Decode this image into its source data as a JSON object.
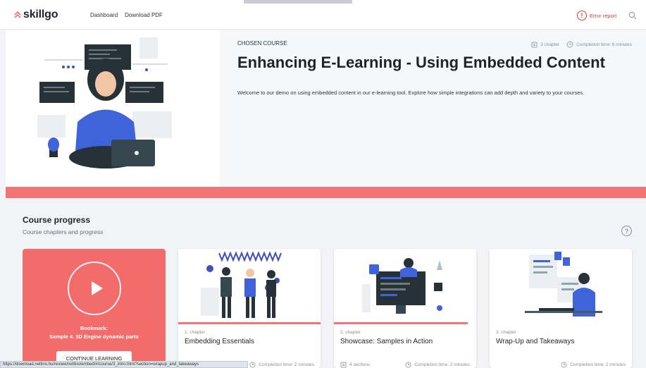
{
  "header": {
    "logo_text": "skillgo",
    "nav": [
      "Dashboard",
      "Download PDF"
    ],
    "error_report": "Error report",
    "error_symbol": "!"
  },
  "hero": {
    "kicker": "CHOSEN COURSE",
    "chapters": "3 chapter",
    "completion": "Completion time: 6 minutes",
    "title": "Enhancing E-Learning - Using Embedded Content",
    "description": "Welcome to our demo on using embedded content in our e-learning tool. Explore how simple integrations can add depth and variety to your courses."
  },
  "progress": {
    "title": "Course progress",
    "subtitle": "Course chapters and progress",
    "help_symbol": "?"
  },
  "bookmark": {
    "label": "Bookmark:",
    "sublabel": "Sample 4. 3D Engine dynamic parts",
    "button": "CONTINUE LEARNING"
  },
  "cards": [
    {
      "num": "1. chapter",
      "title": "Embedding Essentials",
      "sections": "",
      "completion": "Completion time: 2 minutes",
      "progress": 1.0
    },
    {
      "num": "2. chapter",
      "title": "Showcase: Samples in Action",
      "sections": "4 sections",
      "completion": "Completion time: 2 minutes",
      "progress": 0.94
    },
    {
      "num": "3. chapter",
      "title": "Wrap-Up and Takeaways",
      "sections": "",
      "completion": "Completion time: 2 minutes",
      "progress": 0
    }
  ],
  "status_url": "https://download.netlino.hu/review/netlino/embed/#/course/3_intro.html?section=wrapup_and_takeaways",
  "colors": {
    "accent": "#f27474",
    "error": "#e0393b"
  }
}
